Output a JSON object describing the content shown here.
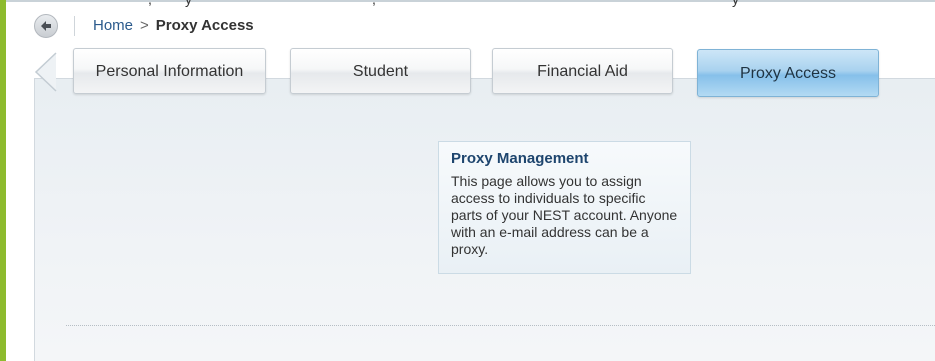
{
  "breadcrumb": {
    "home": "Home",
    "separator": ">",
    "current": "Proxy Access"
  },
  "tabs": [
    {
      "label": "Personal Information",
      "active": false
    },
    {
      "label": "Student",
      "active": false
    },
    {
      "label": "Financial Aid",
      "active": false
    },
    {
      "label": "Proxy Access",
      "active": true
    }
  ],
  "proxy_management": {
    "title": "Proxy Management",
    "body": "This page allows you to assign access to individuals to specific parts of your NEST account. Anyone with an e-mail address can be a proxy."
  },
  "icons": {
    "back": "back-arrow-icon",
    "scroll_left": "chevron-left-icon"
  },
  "colors": {
    "accent": "#8dbb2e",
    "link": "#2b5a8c",
    "active_tab": "#86c0ea",
    "title": "#1e456e"
  }
}
